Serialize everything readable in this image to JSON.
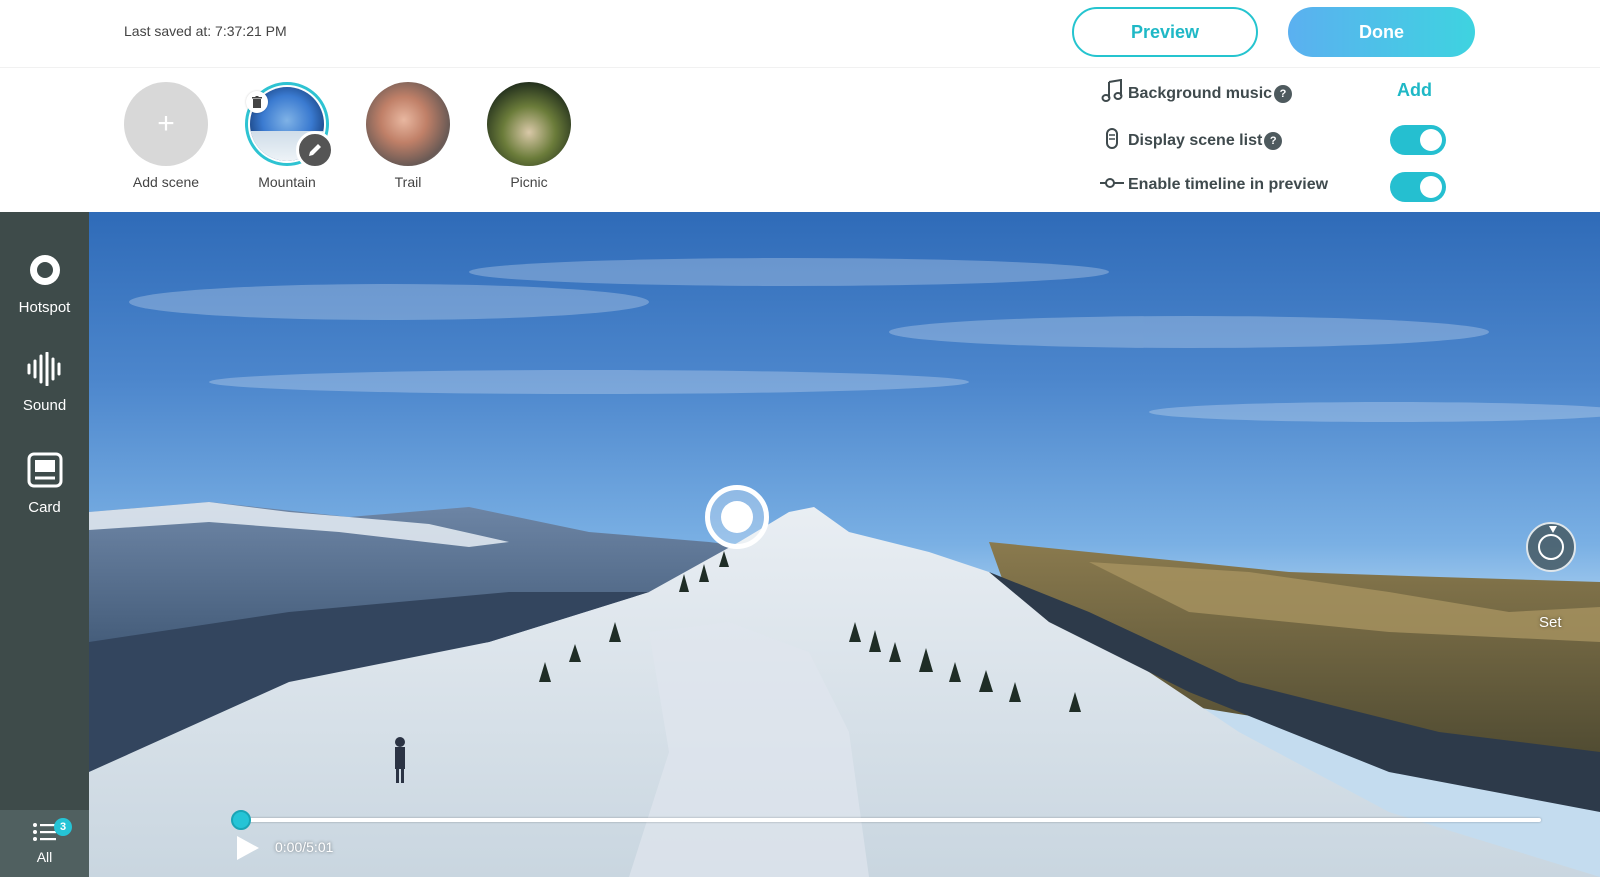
{
  "header": {
    "last_saved": "Last saved at: 7:37:21 PM",
    "preview_label": "Preview",
    "done_label": "Done"
  },
  "scenes": {
    "add_label": "Add scene",
    "add_glyph": "+",
    "items": [
      {
        "label": "Mountain",
        "selected": true
      },
      {
        "label": "Trail",
        "selected": false
      },
      {
        "label": "Picnic",
        "selected": false
      }
    ]
  },
  "settings": {
    "background_music": {
      "label": "Background music",
      "icon": "music-note-icon",
      "help": "?",
      "action": "Add"
    },
    "display_scene_list": {
      "label": "Display scene list",
      "icon": "scene-list-icon",
      "help": "?",
      "enabled": true
    },
    "enable_timeline": {
      "label": "Enable timeline in preview",
      "icon": "timeline-icon",
      "enabled": true
    }
  },
  "toolbar": {
    "hotspot_label": "Hotspot",
    "sound_label": "Sound",
    "card_label": "Card",
    "all_label": "All",
    "all_count": "3"
  },
  "viewer": {
    "set_label": "Set",
    "time": "0:00/5:01",
    "progress": 0
  },
  "colors": {
    "accent": "#25c4d6",
    "sidebar": "#3e4b4a",
    "done_gradient_start": "#5bb0f0",
    "done_gradient_end": "#3ed3e0"
  }
}
